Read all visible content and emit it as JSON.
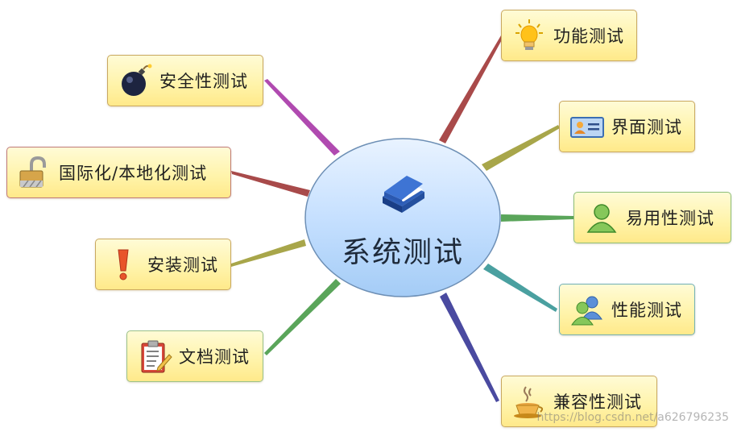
{
  "center": {
    "label": "系统测试",
    "icon": "book-icon"
  },
  "topics": [
    {
      "id": "functional",
      "label": "功能测试",
      "icon": "lightbulb-icon",
      "line_color": "#a94a4a"
    },
    {
      "id": "interface",
      "label": "界面测试",
      "icon": "id-card-icon",
      "line_color": "#a8a64a"
    },
    {
      "id": "usability",
      "label": "易用性测试",
      "icon": "user-icon",
      "line_color": "#5aa55a"
    },
    {
      "id": "performance",
      "label": "性能测试",
      "icon": "users-icon",
      "line_color": "#4aa0a0"
    },
    {
      "id": "compatibility",
      "label": "兼容性测试",
      "icon": "coffee-cup-icon",
      "line_color": "#4a4aa0"
    },
    {
      "id": "security",
      "label": "安全性测试",
      "icon": "bomb-icon",
      "line_color": "#b04ab0"
    },
    {
      "id": "i18n",
      "label": "国际化/本地化测试",
      "icon": "padlock-icon",
      "line_color": "#a84a4a"
    },
    {
      "id": "installation",
      "label": "安装测试",
      "icon": "exclamation-icon",
      "line_color": "#a8a64a"
    },
    {
      "id": "documentation",
      "label": "文档测试",
      "icon": "clipboard-icon",
      "line_color": "#5aa55a"
    }
  ],
  "watermark": "https://blog.csdn.net/a626796235"
}
